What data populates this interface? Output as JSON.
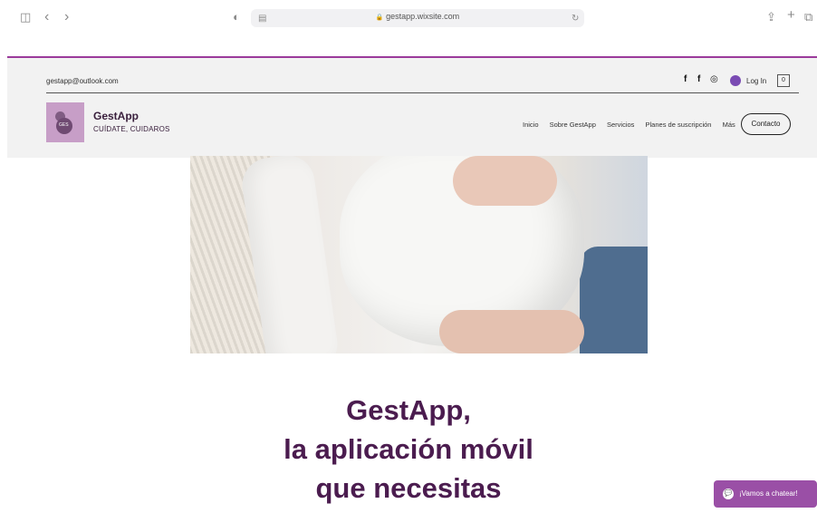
{
  "browser": {
    "url": "gestapp.wixsite.com",
    "lock_glyph": "🔒",
    "sidebar_glyph": "◫",
    "back_glyph": "‹",
    "forward_glyph": "›",
    "shield_glyph": "◐",
    "reader_glyph": "▤",
    "reload_glyph": "↻",
    "share_glyph": "⇪",
    "new_tab_glyph": "+",
    "tabs_glyph": "⧉"
  },
  "header": {
    "email": "gestapp@outlook.com",
    "social": [
      "f",
      "f",
      "◎"
    ],
    "login": "Log In",
    "cart_count": "0",
    "brand": {
      "title": "GestApp",
      "subtitle": "CUÍDATE, CUIDAROS",
      "logo_text": "GES"
    },
    "nav": [
      "Inicio",
      "Sobre GestApp",
      "Servicios",
      "Planes de suscripción",
      "Más"
    ],
    "contact_button": "Contacto"
  },
  "hero": {
    "headline_lines": [
      "GestApp,",
      "la aplicación móvil",
      "que necesitas"
    ]
  },
  "chat": {
    "label": "¡Vamos a chatear!",
    "icon": "💬"
  },
  "colors": {
    "accent": "#9b3b9b",
    "headline": "#4b1c4f",
    "chat_bg": "#9a4fa6"
  }
}
